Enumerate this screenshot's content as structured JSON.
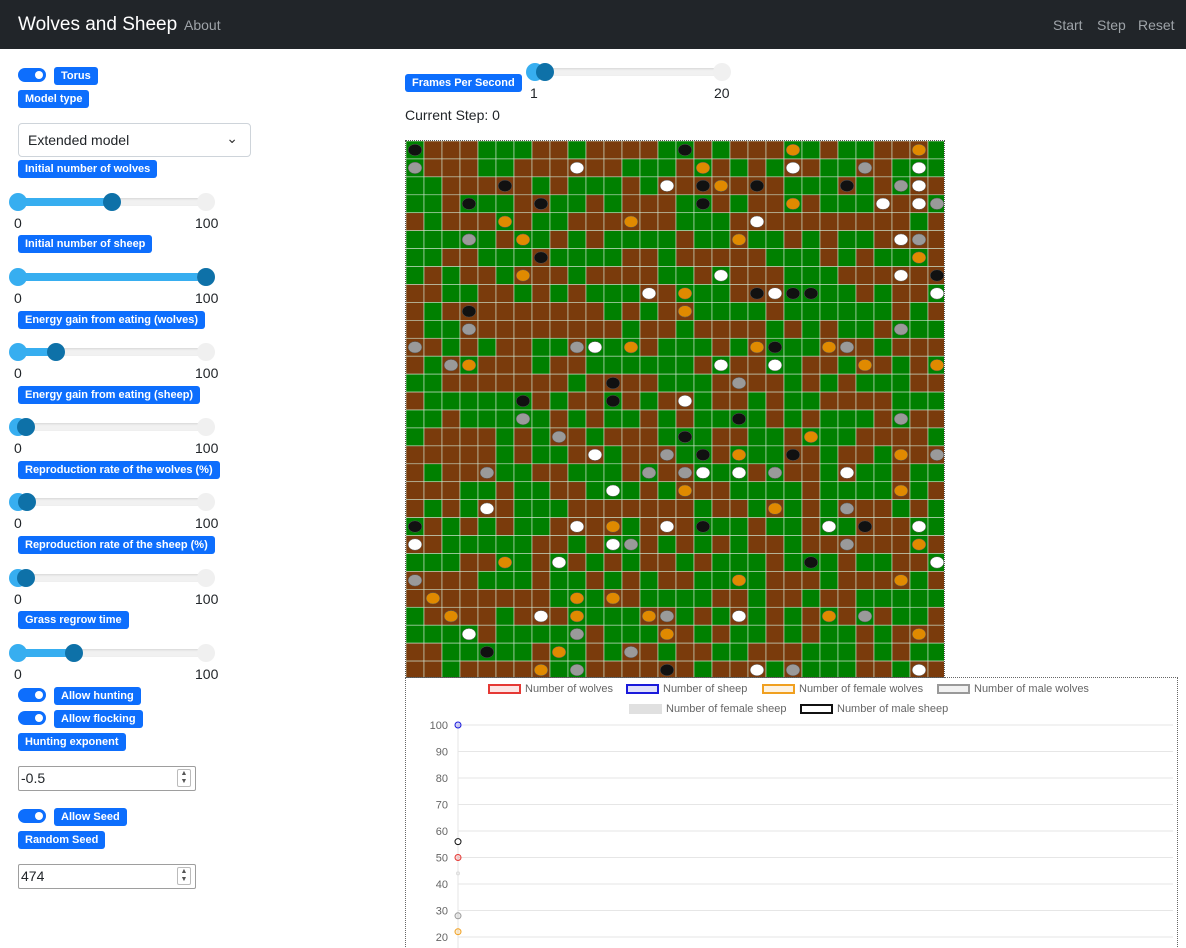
{
  "navbar": {
    "brand": "Wolves and Sheep",
    "about": "About",
    "start": "Start",
    "step": "Step",
    "reset": "Reset"
  },
  "fps": {
    "label": "Frames Per Second",
    "min": "1",
    "max": "20",
    "value": 2
  },
  "current_step": "Current Step: 0",
  "controls": {
    "torus": {
      "label": "Torus",
      "checked": true
    },
    "model_type": {
      "label": "Model type",
      "selected": "Extended model"
    },
    "wolves": {
      "label": "Initial number of wolves",
      "min": "0",
      "max": "100",
      "value": 50
    },
    "sheep": {
      "label": "Initial number of sheep",
      "min": "0",
      "max": "100",
      "value": 100
    },
    "energy_wolves": {
      "label": "Energy gain from eating (wolves)",
      "min": "0",
      "max": "100",
      "value": 20
    },
    "energy_sheep": {
      "label": "Energy gain from eating (sheep)",
      "min": "0",
      "max": "100",
      "value": 4
    },
    "repro_wolves": {
      "label": "Reproduction rate of the wolves (%)",
      "min": "0",
      "max": "100",
      "value": 5
    },
    "repro_sheep": {
      "label": "Reproduction rate of the sheep (%)",
      "min": "0",
      "max": "100",
      "value": 4
    },
    "grass": {
      "label": "Grass regrow time",
      "min": "0",
      "max": "100",
      "value": 30
    },
    "hunting": {
      "label": "Allow hunting",
      "checked": true
    },
    "flocking": {
      "label": "Allow flocking",
      "checked": true
    },
    "hunting_exponent": {
      "label": "Hunting exponent",
      "value": "-0.5"
    },
    "seed_toggle": {
      "label": "Allow Seed",
      "checked": true
    },
    "seed": {
      "label": "Random Seed",
      "value": "474"
    }
  },
  "grid": {
    "cols": 30,
    "rows": 30
  },
  "colors": {
    "grass": "#008000",
    "dirt": "#7a3b0c",
    "accent": "#0d6efd",
    "navbar": "#212529"
  },
  "legend": [
    {
      "label": "Number of wolves",
      "color": "#e53935"
    },
    {
      "label": "Number of sheep",
      "color": "#1a1adb"
    },
    {
      "label": "Number of female wolves",
      "color": "#f0a020"
    },
    {
      "label": "Number of male wolves",
      "color": "#999999"
    },
    {
      "label": "Number of female sheep",
      "color": "#dddddd"
    },
    {
      "label": "Number of male sheep",
      "color": "#111111"
    }
  ],
  "chart_data": {
    "type": "line",
    "x": [
      0
    ],
    "series": [
      {
        "name": "Number of wolves",
        "values": [
          50
        ]
      },
      {
        "name": "Number of sheep",
        "values": [
          100
        ]
      },
      {
        "name": "Number of female wolves",
        "values": [
          22
        ]
      },
      {
        "name": "Number of male wolves",
        "values": [
          28
        ]
      },
      {
        "name": "Number of female sheep",
        "values": [
          44
        ]
      },
      {
        "name": "Number of male sheep",
        "values": [
          56
        ]
      }
    ],
    "yticks": [
      "100",
      "90",
      "80",
      "70",
      "60",
      "50",
      "40",
      "30",
      "20"
    ],
    "ylim": [
      20,
      100
    ],
    "grid": true,
    "legend_position": "top"
  }
}
